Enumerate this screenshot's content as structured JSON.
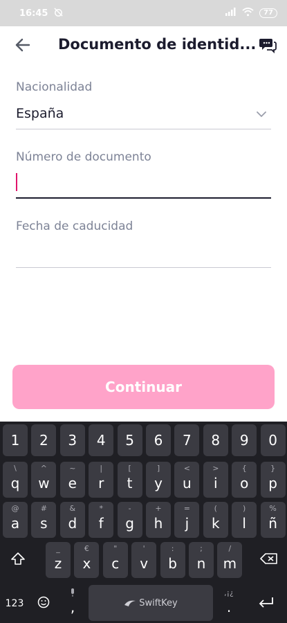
{
  "status_bar": {
    "time": "16:45",
    "battery": "77"
  },
  "app_bar": {
    "title": "Documento de identid...",
    "back_icon": "arrow-left-icon",
    "chat_icon": "chat-bubbles-icon"
  },
  "form": {
    "nationality": {
      "label": "Nacionalidad",
      "value": "España"
    },
    "document_number": {
      "label": "Número de documento",
      "value": ""
    },
    "expiry_date": {
      "label": "Fecha de caducidad",
      "value": ""
    }
  },
  "continue_label": "Continuar",
  "colors": {
    "accent": "#e0136b",
    "button_disabled": "#ffa3c9",
    "text": "#1c1c2e",
    "label": "#7d8396",
    "keyboard_bg": "#1f1f24",
    "key_bg": "#3b3b42"
  },
  "keyboard": {
    "numbers": [
      "1",
      "2",
      "3",
      "4",
      "5",
      "6",
      "7",
      "8",
      "9",
      "0"
    ],
    "row1": [
      {
        "k": "q",
        "h": "\\"
      },
      {
        "k": "w",
        "h": "^"
      },
      {
        "k": "e",
        "h": "~"
      },
      {
        "k": "r",
        "h": "|"
      },
      {
        "k": "t",
        "h": "["
      },
      {
        "k": "y",
        "h": "]"
      },
      {
        "k": "u",
        "h": "<"
      },
      {
        "k": "i",
        "h": ">"
      },
      {
        "k": "o",
        "h": "{"
      },
      {
        "k": "p",
        "h": "}"
      }
    ],
    "row2": [
      {
        "k": "a",
        "h": "@"
      },
      {
        "k": "s",
        "h": "#"
      },
      {
        "k": "d",
        "h": "&"
      },
      {
        "k": "f",
        "h": "*"
      },
      {
        "k": "g",
        "h": "-"
      },
      {
        "k": "h",
        "h": "+"
      },
      {
        "k": "j",
        "h": "="
      },
      {
        "k": "k",
        "h": "("
      },
      {
        "k": "l",
        "h": ")"
      },
      {
        "k": "ñ",
        "h": "%"
      }
    ],
    "row3": [
      {
        "k": "z",
        "h": "_"
      },
      {
        "k": "x",
        "h": "€"
      },
      {
        "k": "c",
        "h": "\""
      },
      {
        "k": "v",
        "h": "'"
      },
      {
        "k": "b",
        "h": ":"
      },
      {
        "k": "n",
        "h": ";"
      },
      {
        "k": "m",
        "h": "/"
      }
    ],
    "bottom": {
      "sym": "123",
      "comma": ",",
      "space": "SwiftKey",
      "period": ".",
      "period_hint": ",¡¿"
    }
  }
}
